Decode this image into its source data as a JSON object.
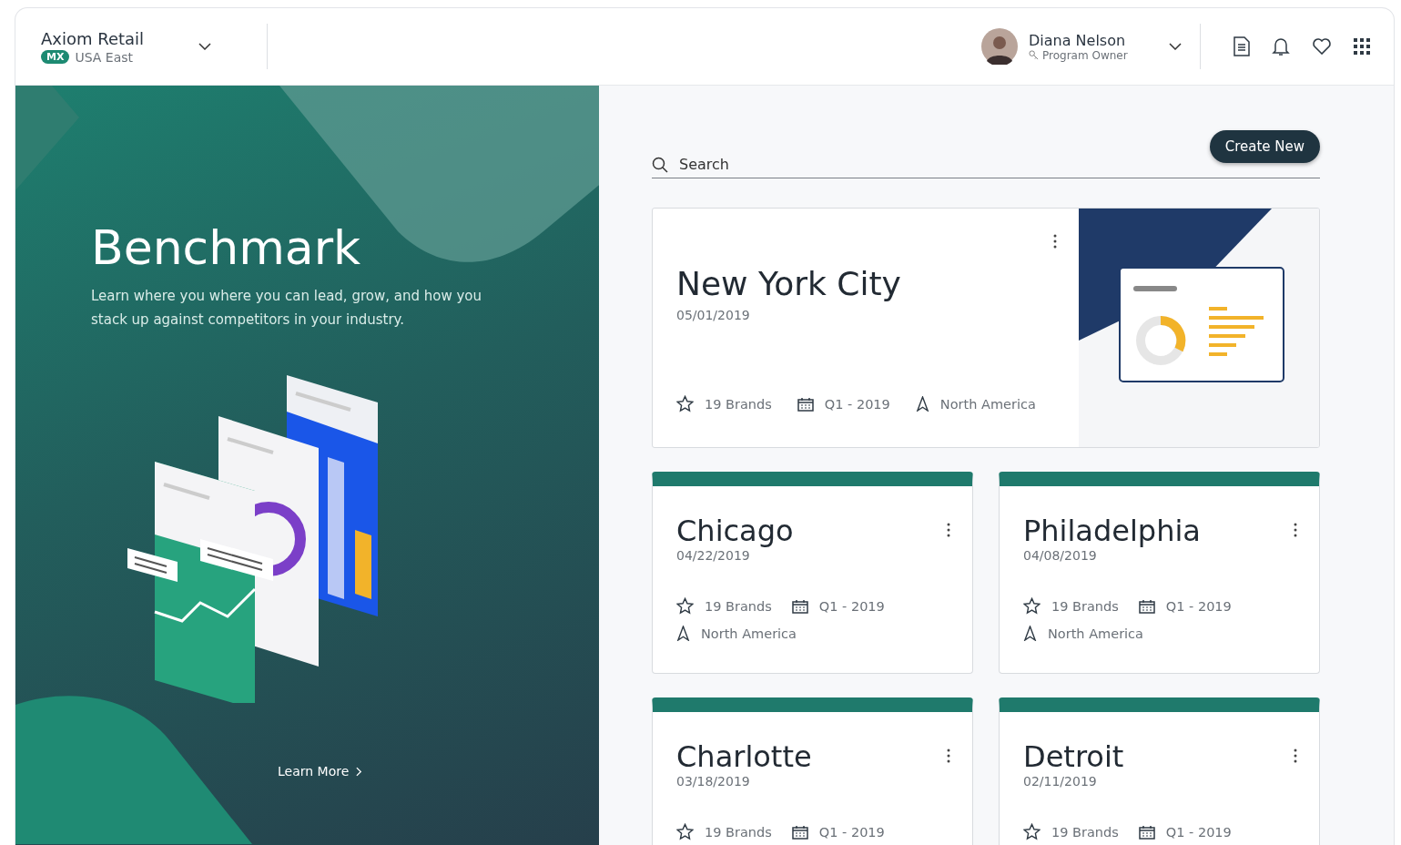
{
  "header": {
    "org_name": "Axiom Retail",
    "org_badge": "MX",
    "org_region": "USA East",
    "user_name": "Diana Nelson",
    "user_role": "Program Owner"
  },
  "hero": {
    "title": "Benchmark",
    "description": "Learn where you where you can lead, grow, and how you stack up against competitors in your industry.",
    "link": "Learn More"
  },
  "search": {
    "placeholder": "Search"
  },
  "create_button": "Create New",
  "cards": [
    {
      "kind": "featured",
      "title": "New York City",
      "date": "05/01/2019",
      "brands": "19 Brands",
      "quarter": "Q1 - 2019",
      "region": "North America"
    },
    {
      "kind": "tile",
      "title": "Chicago",
      "date": "04/22/2019",
      "brands": "19 Brands",
      "quarter": "Q1 - 2019",
      "region": "North America"
    },
    {
      "kind": "tile",
      "title": "Philadelphia",
      "date": "04/08/2019",
      "brands": "19 Brands",
      "quarter": "Q1 - 2019",
      "region": "North America"
    },
    {
      "kind": "tile",
      "title": "Charlotte",
      "date": "03/18/2019",
      "brands": "19 Brands",
      "quarter": "Q1 - 2019"
    },
    {
      "kind": "tile",
      "title": "Detroit",
      "date": "02/11/2019",
      "brands": "19 Brands",
      "quarter": "Q1 - 2019"
    }
  ]
}
